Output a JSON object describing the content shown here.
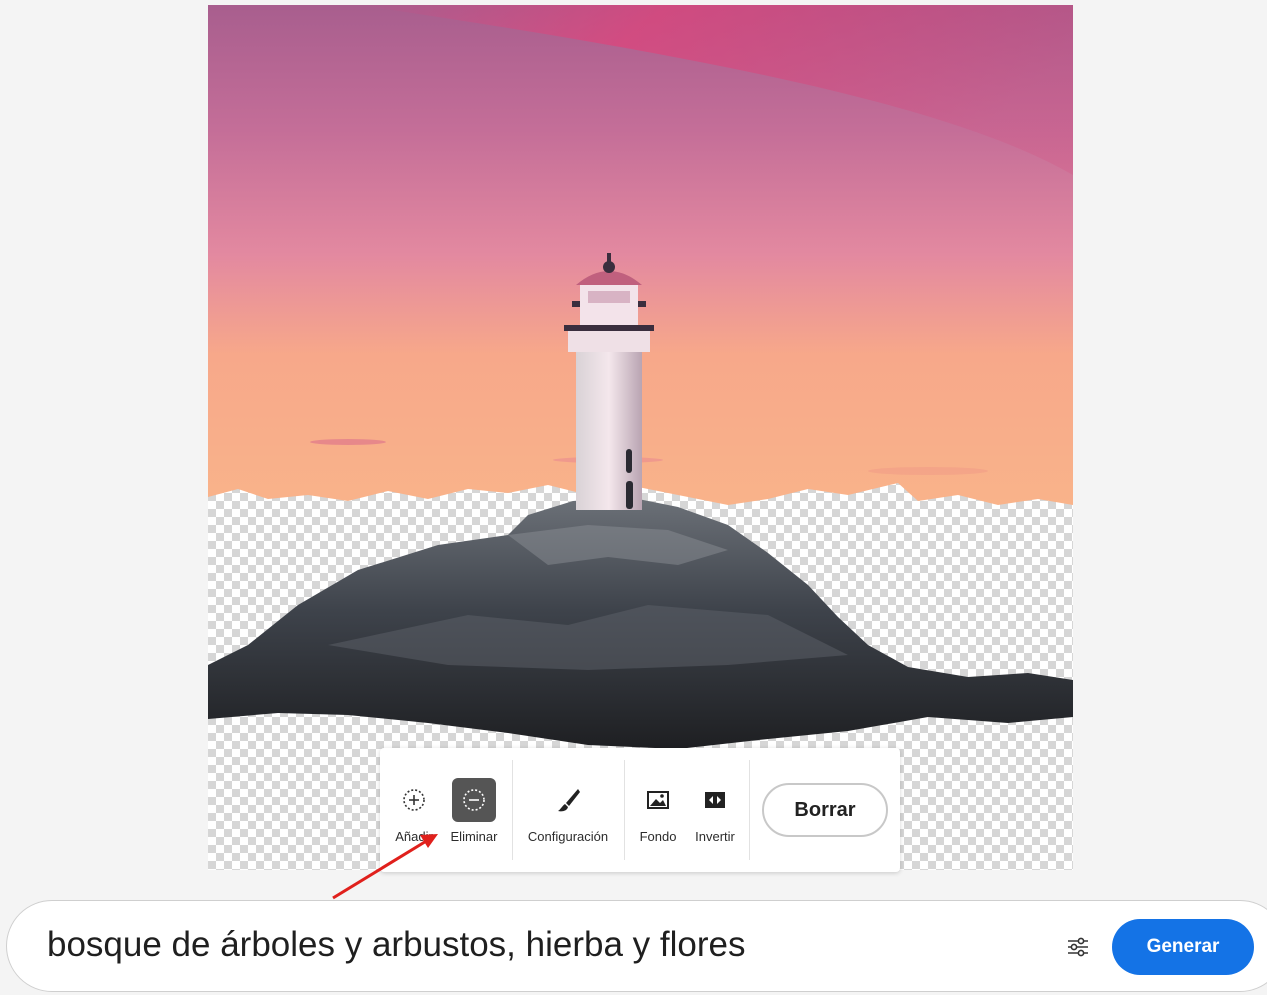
{
  "toolbar": {
    "add_label": "Añadir",
    "remove_label": "Eliminar",
    "settings_label": "Configuración",
    "background_label": "Fondo",
    "invert_label": "Invertir",
    "clear_label": "Borrar",
    "active_tool": "Eliminar"
  },
  "prompt": {
    "text": "bosque de árboles y arbustos, hierba y flores",
    "generate_label": "Generar"
  },
  "icons": {
    "add": "add-selection-icon",
    "remove": "subtract-selection-icon",
    "settings": "brush-icon",
    "background": "image-icon",
    "invert": "invert-icon",
    "prompt_settings": "sliders-icon"
  },
  "colors": {
    "accent": "#1473e6",
    "active_tool_bg": "#555555",
    "annotation_arrow": "#e0201c"
  }
}
